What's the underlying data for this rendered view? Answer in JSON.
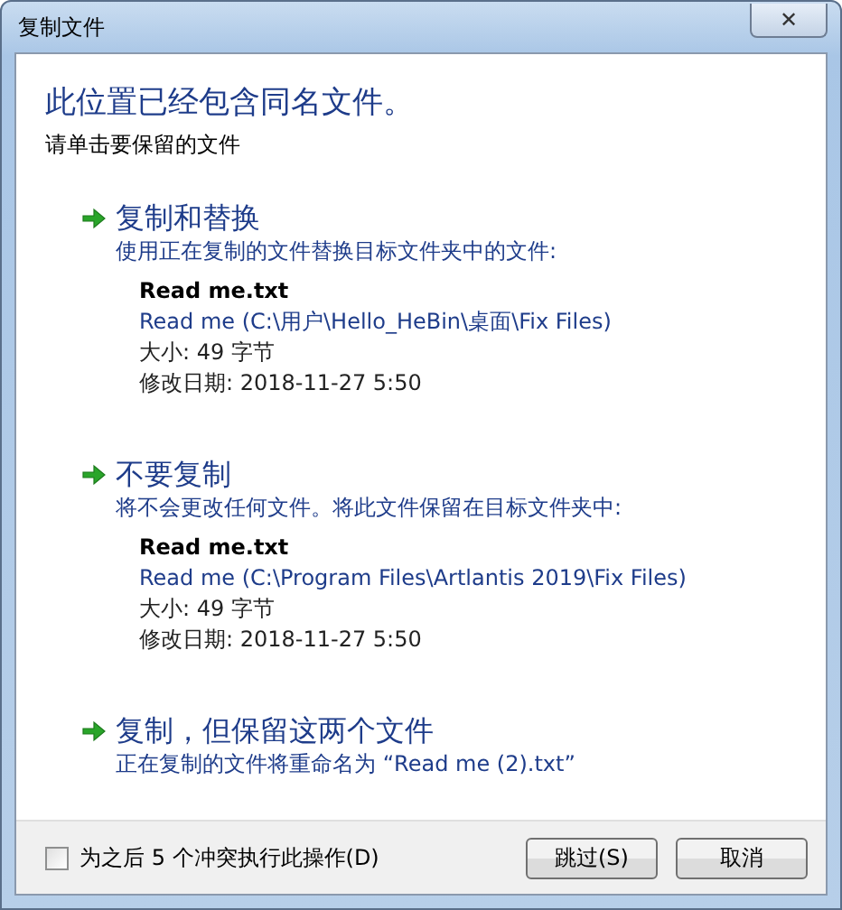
{
  "window": {
    "title": "复制文件",
    "close": "✕"
  },
  "heading": "此位置已经包含同名文件。",
  "instruction": "请单击要保留的文件",
  "options": [
    {
      "kind": "file",
      "title": "复制和替换",
      "description": "使用正在复制的文件替换目标文件夹中的文件:",
      "file": {
        "name": "Read me.txt",
        "path": "Read me (C:\\用户\\Hello_HeBin\\桌面\\Fix Files)",
        "size": "大小: 49 字节",
        "modified": "修改日期: 2018-11-27 5:50"
      }
    },
    {
      "kind": "file",
      "title": "不要复制",
      "description": "将不会更改任何文件。将此文件保留在目标文件夹中:",
      "file": {
        "name": "Read me.txt",
        "path": "Read me (C:\\Program Files\\Artlantis 2019\\Fix Files)",
        "size": "大小: 49 字节",
        "modified": "修改日期: 2018-11-27 5:50"
      }
    },
    {
      "kind": "plain",
      "title": "复制，但保留这两个文件",
      "description": "正在复制的文件将重命名为 “Read me (2).txt”"
    }
  ],
  "footer": {
    "checkbox": {
      "label": "为之后 5 个冲突执行此操作(D)",
      "checked": false
    },
    "buttons": [
      "跳过(S)",
      "取消"
    ]
  }
}
